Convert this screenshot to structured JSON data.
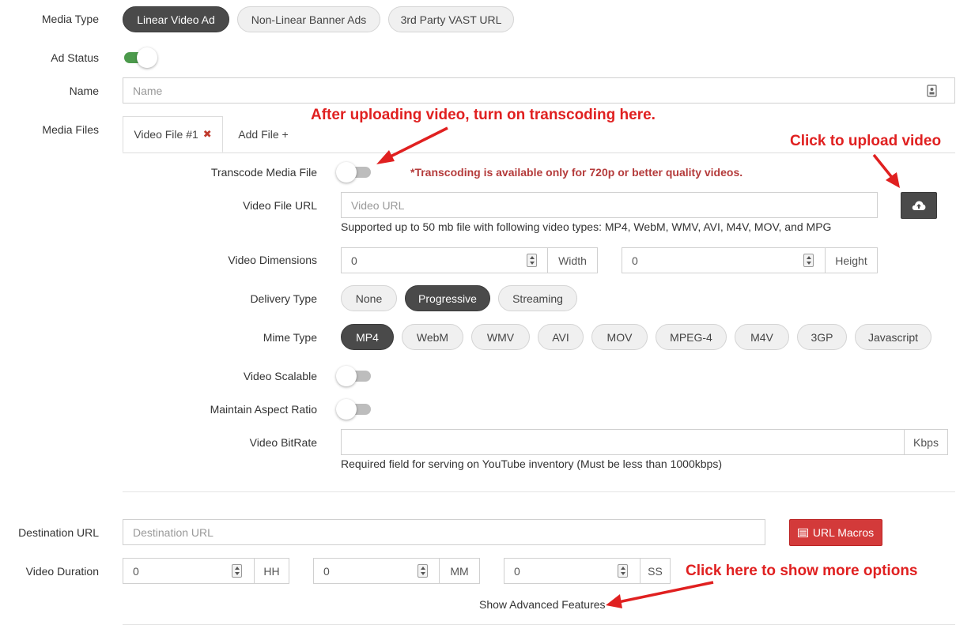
{
  "media_type": {
    "label": "Media Type",
    "options": [
      "Linear Video Ad",
      "Non-Linear Banner Ads",
      "3rd Party VAST URL"
    ],
    "selected": "Linear Video Ad"
  },
  "ad_status": {
    "label": "Ad Status",
    "on": true
  },
  "name": {
    "label": "Name",
    "placeholder": "Name"
  },
  "media_files": {
    "label": "Media Files",
    "tabs": [
      "Video File #1",
      "Add File +"
    ],
    "close_glyph": "✖"
  },
  "transcode": {
    "label": "Transcode Media File",
    "on": false,
    "note": "*Transcoding is available only for 720p or better quality videos."
  },
  "video_url": {
    "label": "Video File URL",
    "placeholder": "Video URL",
    "help": "Supported up to 50 mb file with following video types: MP4, WebM, WMV, AVI, M4V, MOV, and MPG"
  },
  "dimensions": {
    "label": "Video Dimensions",
    "width_value": "0",
    "width_unit": "Width",
    "height_value": "0",
    "height_unit": "Height"
  },
  "delivery": {
    "label": "Delivery Type",
    "options": [
      "None",
      "Progressive",
      "Streaming"
    ],
    "selected": "Progressive"
  },
  "mime": {
    "label": "Mime Type",
    "options": [
      "MP4",
      "WebM",
      "WMV",
      "AVI",
      "MOV",
      "MPEG-4",
      "M4V",
      "3GP",
      "Javascript"
    ],
    "selected": "MP4"
  },
  "scalable": {
    "label": "Video Scalable",
    "on": false
  },
  "aspect": {
    "label": "Maintain Aspect Ratio",
    "on": false
  },
  "bitrate": {
    "label": "Video BitRate",
    "value": "",
    "unit": "Kbps",
    "help": "Required field for serving on YouTube inventory (Must be less than 1000kbps)"
  },
  "destination": {
    "label": "Destination URL",
    "placeholder": "Destination URL",
    "macros_label": "URL Macros"
  },
  "duration": {
    "label": "Video Duration",
    "hh": "0",
    "hh_unit": "HH",
    "mm": "0",
    "mm_unit": "MM",
    "ss": "0",
    "ss_unit": "SS"
  },
  "advanced_link": "Show Advanced Features",
  "annotations": {
    "transcode_tip": "After uploading video, turn on transcoding here.",
    "upload_tip": "Click to upload video",
    "more_tip": "Click here to show more options"
  },
  "colors": {
    "accent_dark": "#4a4a4a",
    "toggle_on": "#4c9a4c",
    "callout": "#e02020",
    "macros": "#d33a3a"
  },
  "icons": [
    "id-card-icon",
    "cloud-upload-icon",
    "list-icon",
    "close-icon",
    "spinner-icon"
  ]
}
